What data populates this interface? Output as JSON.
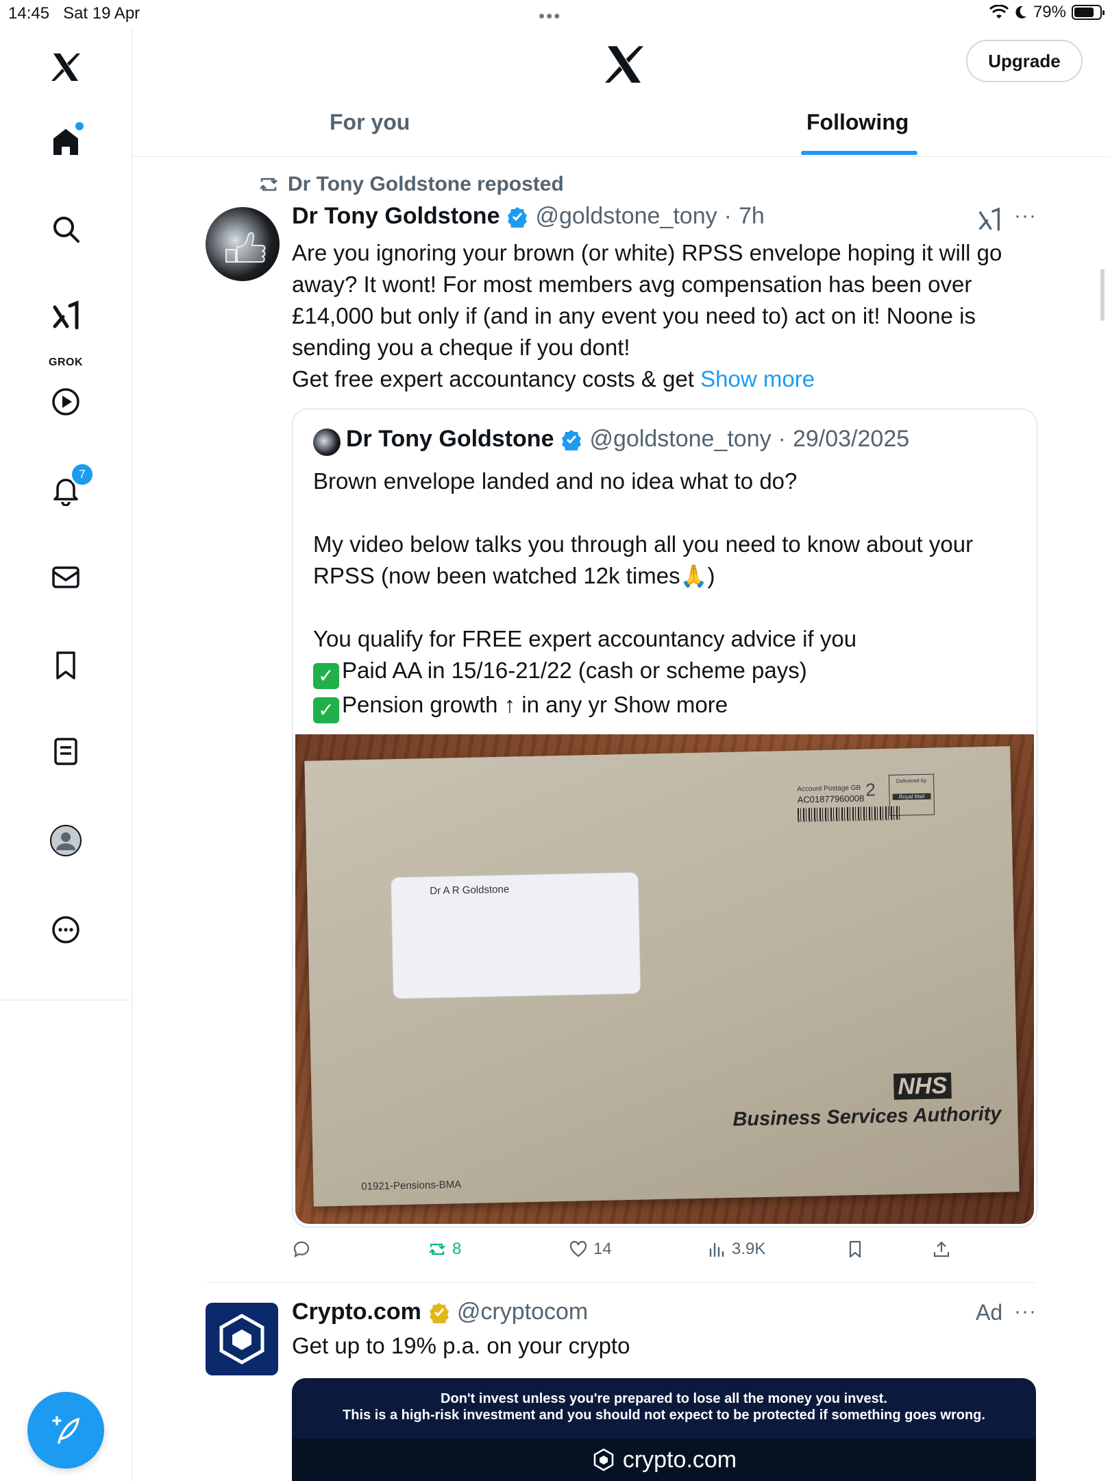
{
  "status_bar": {
    "time": "14:45",
    "date": "Sat 19 Apr",
    "battery": "79%",
    "battery_level": 0.79,
    "dots": "•••"
  },
  "header": {
    "upgrade_label": "Upgrade",
    "tabs": [
      {
        "label": "For you",
        "active": false
      },
      {
        "label": "Following",
        "active": true
      }
    ]
  },
  "sidebar": {
    "grok_label": "GROK",
    "notifications_badge": "7",
    "items": [
      "home-icon",
      "search-icon",
      "grok-icon",
      "video-icon",
      "notifications-icon",
      "messages-icon",
      "bookmarks-icon",
      "lists-icon",
      "profile-icon",
      "more-icon"
    ]
  },
  "tweet": {
    "repost_text": "Dr Tony Goldstone reposted",
    "author_name": "Dr Tony Goldstone",
    "author_handle": "@goldstone_tony",
    "separator": "·",
    "time": "7h",
    "text": "Are you ignoring your brown (or white) RPSS envelope hoping it will go away? It wont! For most members avg compensation has been over £14,000 but only if (and in any event you need to) act on it! Noone is sending you a cheque if you dont!\nGet free expert accountancy costs & get ",
    "show_more": "Show more",
    "more_menu": "···"
  },
  "quote": {
    "author_name": "Dr Tony Goldstone",
    "author_handle": "@goldstone_tony",
    "separator": "·",
    "date": "29/03/2025",
    "line1": "Brown envelope landed and no idea what to do?",
    "line2": "My video below talks you through all you need to know about your RPSS (now been watched 12k times",
    "line2_emoji": "🙏",
    "line2_end": ")",
    "line3": "You qualify for FREE expert accountancy advice if you",
    "check_glyph": "✓",
    "bullet1": "Paid AA in 15/16-21/22 (cash or scheme pays)",
    "bullet2": "Pension growth ↑ in any yr Show more",
    "photo": {
      "address": "Dr A R Goldstone",
      "postage_label": "Account Postage GB",
      "postage_code": "AC01877960008",
      "class_number": "2",
      "delivered_by": "Delivered by",
      "royal_mail": "Royal Mail",
      "nhs": "NHS",
      "bsa": "Business Services Authority",
      "ref_code": "01921-Pensions-BMA"
    }
  },
  "actions": {
    "reply_count": "",
    "repost_count": "8",
    "like_count": "14",
    "views_count": "3.9K"
  },
  "ad": {
    "name": "Crypto.com",
    "handle": "@cryptocom",
    "ad_label": "Ad",
    "more_menu": "···",
    "text": "Get up to 19% p.a. on your crypto",
    "warning_line1": "Don't invest unless you're prepared to lose all the money you invest.",
    "warning_line2": "This is a high-risk investment and you should not expect to be protected if something goes wrong.",
    "brand": "crypto.com"
  },
  "colors": {
    "accent": "#1d9bf0",
    "repost_green": "#00ba7c",
    "muted_text": "#536471",
    "verified_gold": "#e2b719"
  }
}
